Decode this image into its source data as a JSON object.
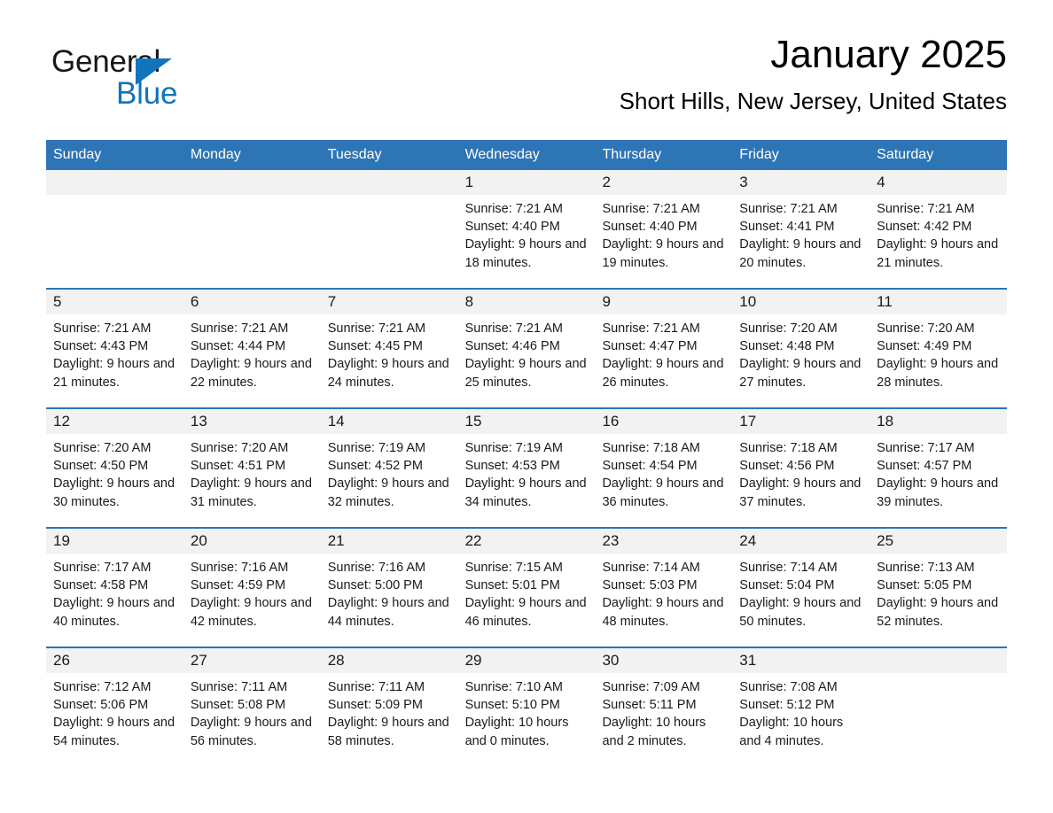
{
  "brand": {
    "name_part1": "General",
    "name_part2": "Blue",
    "triangle_icon": "triangle-logo-icon",
    "accent_color": "#1274bc"
  },
  "header": {
    "title": "January 2025",
    "subtitle": "Short Hills, New Jersey, United States"
  },
  "theme": {
    "header_blue": "#2e75b6",
    "daynum_band": "#f2f2f2",
    "text": "#1a1a1a"
  },
  "calendar": {
    "weekday_headers": [
      "Sunday",
      "Monday",
      "Tuesday",
      "Wednesday",
      "Thursday",
      "Friday",
      "Saturday"
    ],
    "weeks": [
      [
        {
          "day": "",
          "sunrise": "",
          "sunset": "",
          "daylight": "",
          "empty": true
        },
        {
          "day": "",
          "sunrise": "",
          "sunset": "",
          "daylight": "",
          "empty": true
        },
        {
          "day": "",
          "sunrise": "",
          "sunset": "",
          "daylight": "",
          "empty": true
        },
        {
          "day": "1",
          "sunrise": "Sunrise: 7:21 AM",
          "sunset": "Sunset: 4:40 PM",
          "daylight": "Daylight: 9 hours and 18 minutes.",
          "empty": false
        },
        {
          "day": "2",
          "sunrise": "Sunrise: 7:21 AM",
          "sunset": "Sunset: 4:40 PM",
          "daylight": "Daylight: 9 hours and 19 minutes.",
          "empty": false
        },
        {
          "day": "3",
          "sunrise": "Sunrise: 7:21 AM",
          "sunset": "Sunset: 4:41 PM",
          "daylight": "Daylight: 9 hours and 20 minutes.",
          "empty": false
        },
        {
          "day": "4",
          "sunrise": "Sunrise: 7:21 AM",
          "sunset": "Sunset: 4:42 PM",
          "daylight": "Daylight: 9 hours and 21 minutes.",
          "empty": false
        }
      ],
      [
        {
          "day": "5",
          "sunrise": "Sunrise: 7:21 AM",
          "sunset": "Sunset: 4:43 PM",
          "daylight": "Daylight: 9 hours and 21 minutes.",
          "empty": false
        },
        {
          "day": "6",
          "sunrise": "Sunrise: 7:21 AM",
          "sunset": "Sunset: 4:44 PM",
          "daylight": "Daylight: 9 hours and 22 minutes.",
          "empty": false
        },
        {
          "day": "7",
          "sunrise": "Sunrise: 7:21 AM",
          "sunset": "Sunset: 4:45 PM",
          "daylight": "Daylight: 9 hours and 24 minutes.",
          "empty": false
        },
        {
          "day": "8",
          "sunrise": "Sunrise: 7:21 AM",
          "sunset": "Sunset: 4:46 PM",
          "daylight": "Daylight: 9 hours and 25 minutes.",
          "empty": false
        },
        {
          "day": "9",
          "sunrise": "Sunrise: 7:21 AM",
          "sunset": "Sunset: 4:47 PM",
          "daylight": "Daylight: 9 hours and 26 minutes.",
          "empty": false
        },
        {
          "day": "10",
          "sunrise": "Sunrise: 7:20 AM",
          "sunset": "Sunset: 4:48 PM",
          "daylight": "Daylight: 9 hours and 27 minutes.",
          "empty": false
        },
        {
          "day": "11",
          "sunrise": "Sunrise: 7:20 AM",
          "sunset": "Sunset: 4:49 PM",
          "daylight": "Daylight: 9 hours and 28 minutes.",
          "empty": false
        }
      ],
      [
        {
          "day": "12",
          "sunrise": "Sunrise: 7:20 AM",
          "sunset": "Sunset: 4:50 PM",
          "daylight": "Daylight: 9 hours and 30 minutes.",
          "empty": false
        },
        {
          "day": "13",
          "sunrise": "Sunrise: 7:20 AM",
          "sunset": "Sunset: 4:51 PM",
          "daylight": "Daylight: 9 hours and 31 minutes.",
          "empty": false
        },
        {
          "day": "14",
          "sunrise": "Sunrise: 7:19 AM",
          "sunset": "Sunset: 4:52 PM",
          "daylight": "Daylight: 9 hours and 32 minutes.",
          "empty": false
        },
        {
          "day": "15",
          "sunrise": "Sunrise: 7:19 AM",
          "sunset": "Sunset: 4:53 PM",
          "daylight": "Daylight: 9 hours and 34 minutes.",
          "empty": false
        },
        {
          "day": "16",
          "sunrise": "Sunrise: 7:18 AM",
          "sunset": "Sunset: 4:54 PM",
          "daylight": "Daylight: 9 hours and 36 minutes.",
          "empty": false
        },
        {
          "day": "17",
          "sunrise": "Sunrise: 7:18 AM",
          "sunset": "Sunset: 4:56 PM",
          "daylight": "Daylight: 9 hours and 37 minutes.",
          "empty": false
        },
        {
          "day": "18",
          "sunrise": "Sunrise: 7:17 AM",
          "sunset": "Sunset: 4:57 PM",
          "daylight": "Daylight: 9 hours and 39 minutes.",
          "empty": false
        }
      ],
      [
        {
          "day": "19",
          "sunrise": "Sunrise: 7:17 AM",
          "sunset": "Sunset: 4:58 PM",
          "daylight": "Daylight: 9 hours and 40 minutes.",
          "empty": false
        },
        {
          "day": "20",
          "sunrise": "Sunrise: 7:16 AM",
          "sunset": "Sunset: 4:59 PM",
          "daylight": "Daylight: 9 hours and 42 minutes.",
          "empty": false
        },
        {
          "day": "21",
          "sunrise": "Sunrise: 7:16 AM",
          "sunset": "Sunset: 5:00 PM",
          "daylight": "Daylight: 9 hours and 44 minutes.",
          "empty": false
        },
        {
          "day": "22",
          "sunrise": "Sunrise: 7:15 AM",
          "sunset": "Sunset: 5:01 PM",
          "daylight": "Daylight: 9 hours and 46 minutes.",
          "empty": false
        },
        {
          "day": "23",
          "sunrise": "Sunrise: 7:14 AM",
          "sunset": "Sunset: 5:03 PM",
          "daylight": "Daylight: 9 hours and 48 minutes.",
          "empty": false
        },
        {
          "day": "24",
          "sunrise": "Sunrise: 7:14 AM",
          "sunset": "Sunset: 5:04 PM",
          "daylight": "Daylight: 9 hours and 50 minutes.",
          "empty": false
        },
        {
          "day": "25",
          "sunrise": "Sunrise: 7:13 AM",
          "sunset": "Sunset: 5:05 PM",
          "daylight": "Daylight: 9 hours and 52 minutes.",
          "empty": false
        }
      ],
      [
        {
          "day": "26",
          "sunrise": "Sunrise: 7:12 AM",
          "sunset": "Sunset: 5:06 PM",
          "daylight": "Daylight: 9 hours and 54 minutes.",
          "empty": false
        },
        {
          "day": "27",
          "sunrise": "Sunrise: 7:11 AM",
          "sunset": "Sunset: 5:08 PM",
          "daylight": "Daylight: 9 hours and 56 minutes.",
          "empty": false
        },
        {
          "day": "28",
          "sunrise": "Sunrise: 7:11 AM",
          "sunset": "Sunset: 5:09 PM",
          "daylight": "Daylight: 9 hours and 58 minutes.",
          "empty": false
        },
        {
          "day": "29",
          "sunrise": "Sunrise: 7:10 AM",
          "sunset": "Sunset: 5:10 PM",
          "daylight": "Daylight: 10 hours and 0 minutes.",
          "empty": false
        },
        {
          "day": "30",
          "sunrise": "Sunrise: 7:09 AM",
          "sunset": "Sunset: 5:11 PM",
          "daylight": "Daylight: 10 hours and 2 minutes.",
          "empty": false
        },
        {
          "day": "31",
          "sunrise": "Sunrise: 7:08 AM",
          "sunset": "Sunset: 5:12 PM",
          "daylight": "Daylight: 10 hours and 4 minutes.",
          "empty": false
        },
        {
          "day": "",
          "sunrise": "",
          "sunset": "",
          "daylight": "",
          "empty": true
        }
      ]
    ]
  }
}
